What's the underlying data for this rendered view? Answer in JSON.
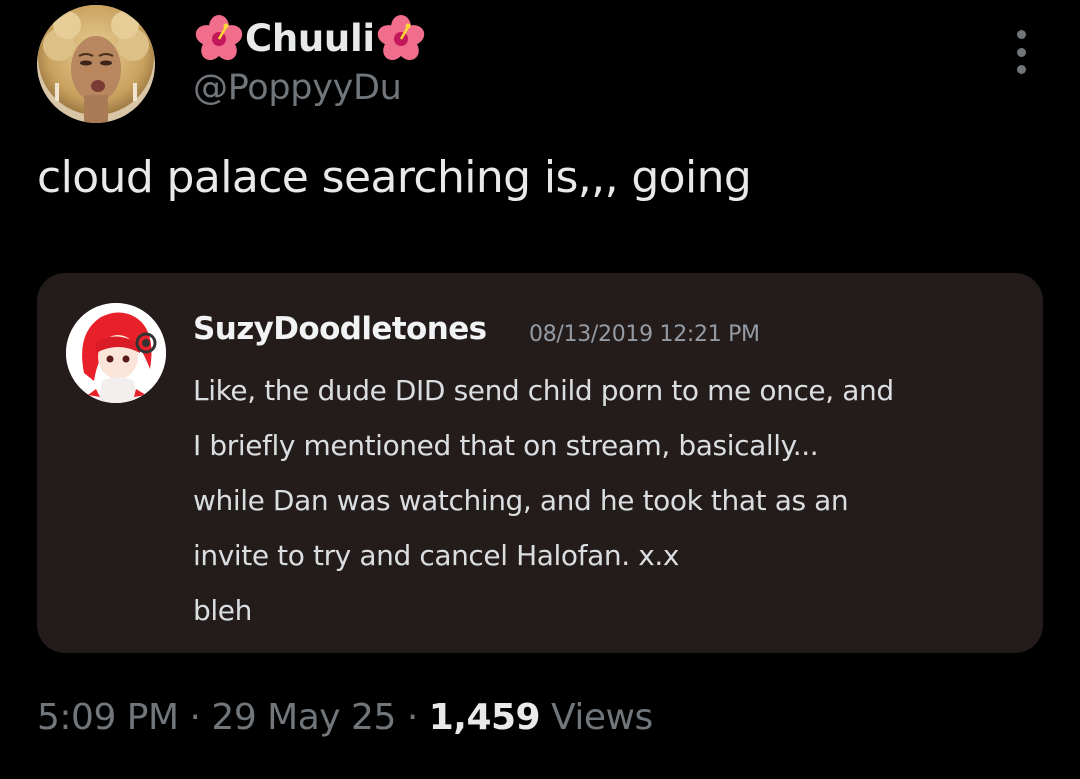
{
  "author": {
    "display_name": "Chuuli",
    "handle": "@PoppyyDu",
    "name_emoji": "hibiscus-icon"
  },
  "tweet": {
    "text": "cloud palace searching is,,, going",
    "time": "5:09 PM",
    "separator": "·",
    "date": "29 May 25",
    "views_count": "1,459",
    "views_label": "Views"
  },
  "embed": {
    "username": "SuzyDoodletones",
    "timestamp": "08/13/2019 12:21 PM",
    "lines": [
      "Like, the dude DID send child porn to me once, and",
      "I briefly mentioned that on stream, basically...",
      "while Dan was watching, and he took that as an",
      "invite to try and cancel Halofan. x.x",
      "bleh"
    ]
  },
  "colors": {
    "background": "#000000",
    "primary_text": "#e7e9ea",
    "secondary_text": "#71767b",
    "embed_background": "#241c1a",
    "embed_text": "#dbdee1",
    "embed_timestamp": "#949ba4"
  }
}
